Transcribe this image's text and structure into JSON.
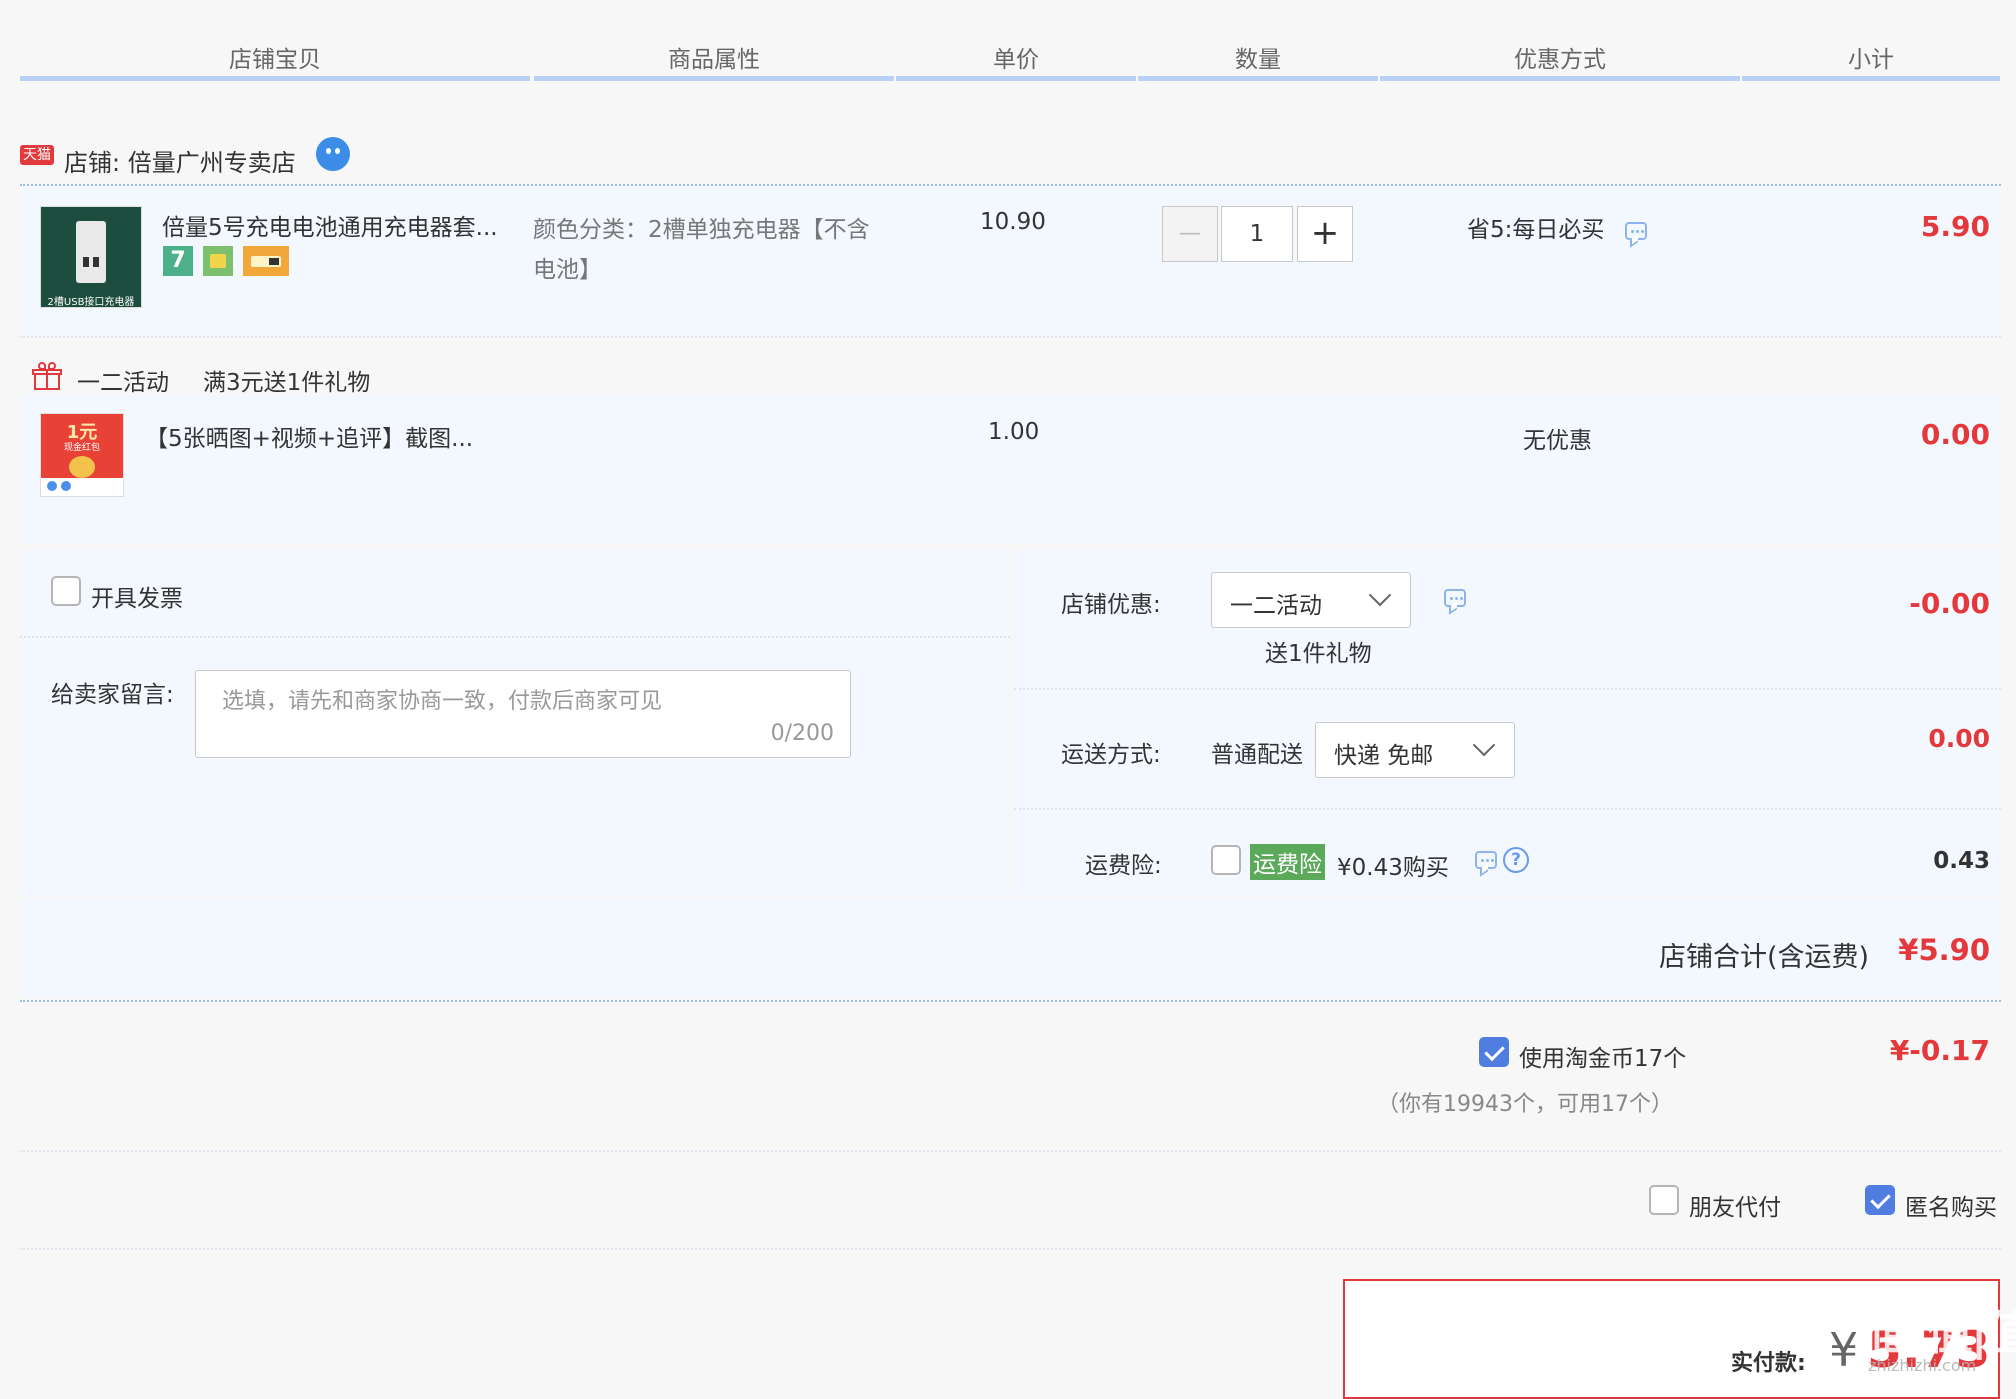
{
  "header": {
    "columns": [
      "店铺宝贝",
      "商品属性",
      "单价",
      "数量",
      "优惠方式",
      "小计"
    ]
  },
  "shop": {
    "badge": "天猫",
    "label": "店铺: 倍量广州专卖店"
  },
  "item1": {
    "thumb_caption": "2槽USB接口充电器",
    "title": "倍量5号充电电池通用充电器套...",
    "badge_seven": "7",
    "attr_line1": "颜色分类：2槽单独充电器【不含",
    "attr_line2": "电池】",
    "unit_price": "10.90",
    "quantity": "1",
    "minus": "—",
    "plus": "+",
    "discount": "省5:每日必买",
    "subtotal": "5.90"
  },
  "gift_section": {
    "activity": "一二活动",
    "rule": "满3元送1件礼物"
  },
  "item2": {
    "thumb_price": "1元",
    "thumb_sub": "现金红包",
    "title": "【5张晒图+视频+追评】截图...",
    "unit_price": "1.00",
    "discount": "无优惠",
    "subtotal": "0.00"
  },
  "invoice": {
    "label": "开具发票",
    "checked": false
  },
  "message": {
    "label": "给卖家留言:",
    "placeholder": "选填，请先和商家协商一致，付款后商家可见",
    "counter": "0/200"
  },
  "shop_discount": {
    "label": "店铺优惠:",
    "selected": "一二活动",
    "note": "送1件礼物",
    "amount": "-0.00"
  },
  "shipping": {
    "label": "运送方式:",
    "method": "普通配送",
    "selected": "快递 免邮",
    "amount": "0.00"
  },
  "insurance": {
    "label": "运费险:",
    "tag": "运费险",
    "price": "¥0.43购买",
    "amount": "0.43",
    "checked": false
  },
  "shop_total": {
    "label": "店铺合计(含运费)",
    "amount": "¥5.90"
  },
  "coins": {
    "label": "使用淘金币17个",
    "note": "（你有19943个，可用17个）",
    "amount": "¥-0.17",
    "checked": true
  },
  "options": {
    "friend_pay": "朋友代付",
    "friend_pay_checked": false,
    "anonymous": "匿名购买",
    "anonymous_checked": true
  },
  "payment": {
    "label": "实付款:",
    "currency": "¥",
    "amount": "5.73"
  },
  "watermark": {
    "text": "值|值|值",
    "site": "zhizhizhi.com"
  },
  "colors": {
    "accent_red": "#e4393c",
    "header_line": "#b8d0f3",
    "check_blue": "#4f7de0",
    "row_bg": "#f3f8fe"
  }
}
